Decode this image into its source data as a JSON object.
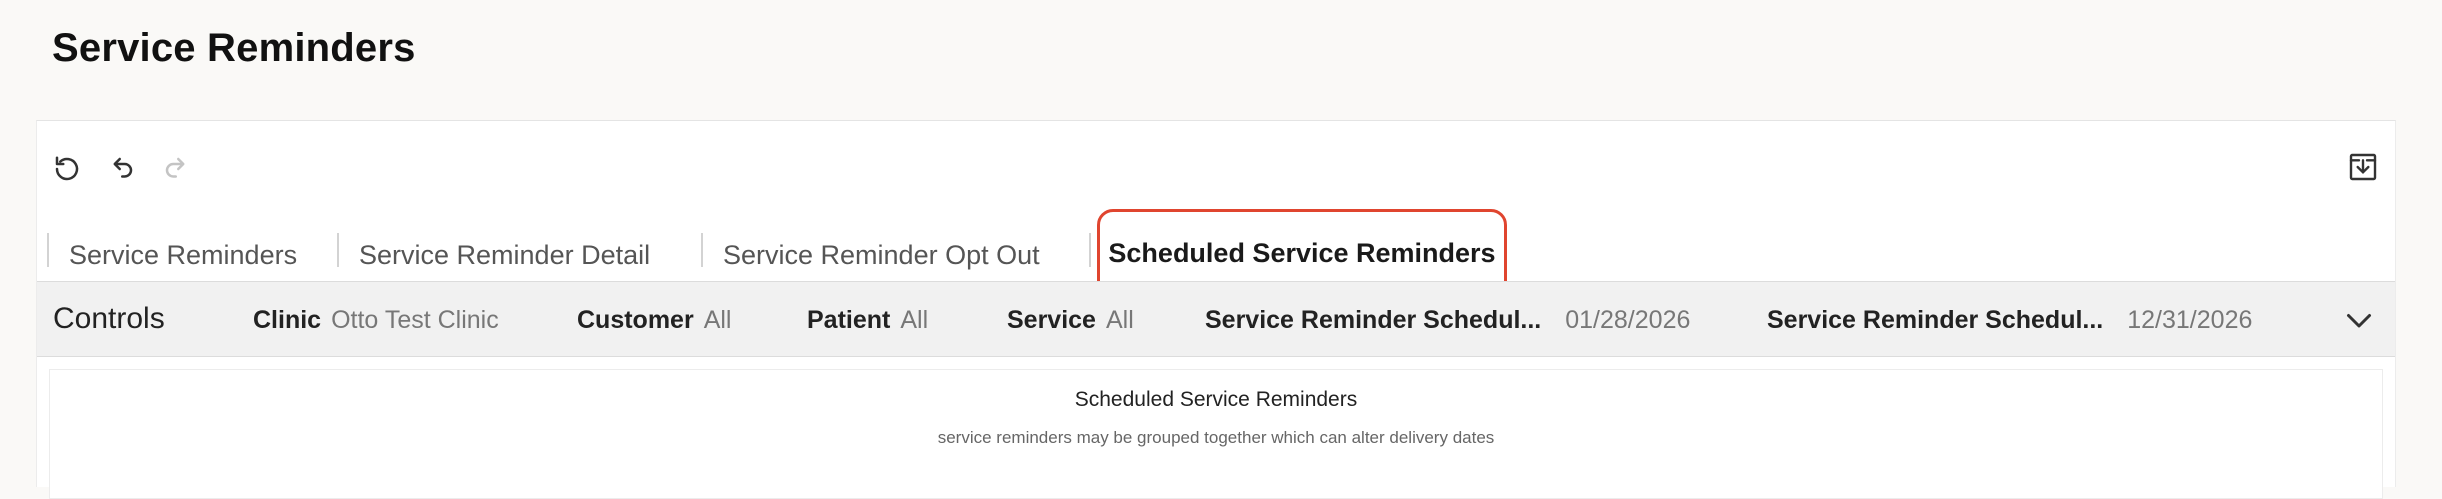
{
  "page": {
    "title": "Service Reminders"
  },
  "toolbar": {
    "refresh_icon": "refresh-icon",
    "undo_icon": "undo-icon",
    "redo_icon": "redo-icon",
    "export_icon": "export-icon"
  },
  "tabs": [
    {
      "label": "Service Reminders",
      "active": false
    },
    {
      "label": "Service Reminder Detail",
      "active": false
    },
    {
      "label": "Service Reminder Opt Out",
      "active": false
    },
    {
      "label": "Scheduled Service Reminders",
      "active": true
    }
  ],
  "controls": {
    "title": "Controls",
    "filters": [
      {
        "label": "Clinic",
        "value": "Otto Test Clinic"
      },
      {
        "label": "Customer",
        "value": "All"
      },
      {
        "label": "Patient",
        "value": "All"
      },
      {
        "label": "Service",
        "value": "All"
      },
      {
        "label": "Service Reminder Schedul...",
        "value": "01/28/2026"
      },
      {
        "label": "Service Reminder Schedul...",
        "value": "12/31/2026"
      }
    ]
  },
  "report": {
    "title": "Scheduled Service Reminders",
    "subtitle": "service reminders may be grouped together which can alter delivery dates"
  },
  "colors": {
    "active_tab_border": "#e0452f",
    "controls_bg": "#f1f1f1"
  }
}
